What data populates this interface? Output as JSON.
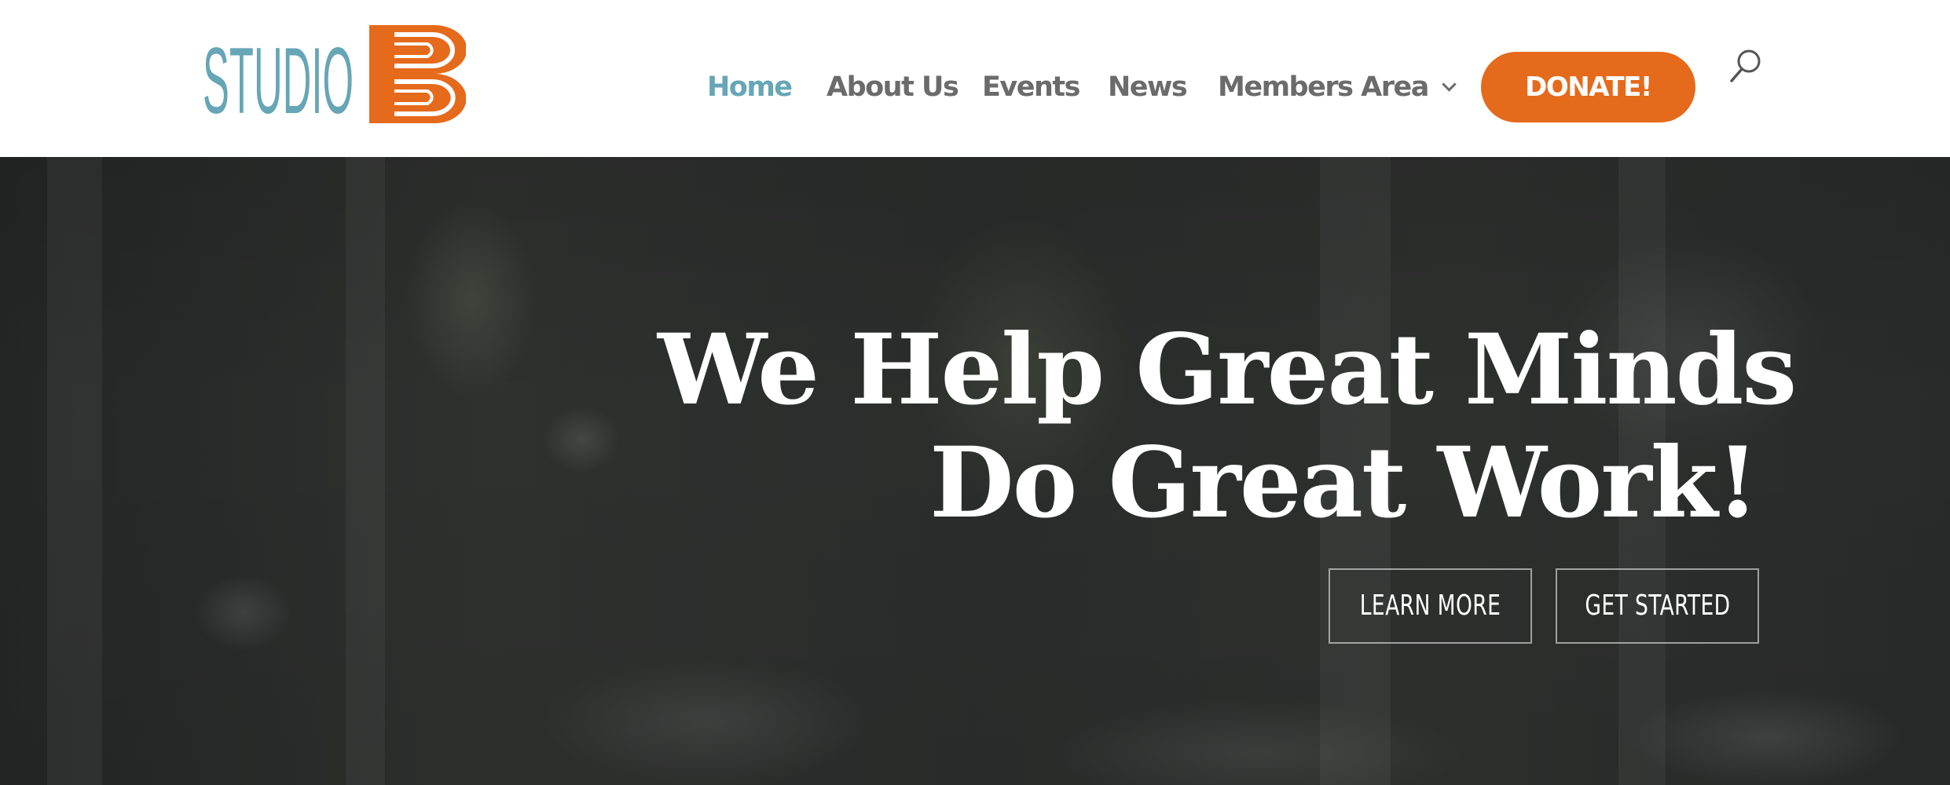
{
  "header": {
    "logo": {
      "text_left": "STUDIO",
      "text_right": "B",
      "colors": {
        "teal": "#66a6b6",
        "orange": "#e56a1b"
      }
    },
    "nav": [
      {
        "label": "Home",
        "active": true
      },
      {
        "label": "About Us",
        "active": false
      },
      {
        "label": "Events",
        "active": false
      },
      {
        "label": "News",
        "active": false
      },
      {
        "label": "Members Area",
        "active": false,
        "has_dropdown": true
      }
    ],
    "donate_label": "DONATE!",
    "search_icon": "search-icon"
  },
  "hero": {
    "title_line1": "We Help Great Minds",
    "title_line2": "Do Great Work!",
    "buttons": {
      "learn_more": "LEARN MORE",
      "get_started": "GET STARTED"
    }
  },
  "colors": {
    "accent_teal": "#66a6b6",
    "accent_orange": "#e56a1b",
    "nav_text": "#6b6b6b",
    "hero_overlay": "#2a2c2c"
  }
}
